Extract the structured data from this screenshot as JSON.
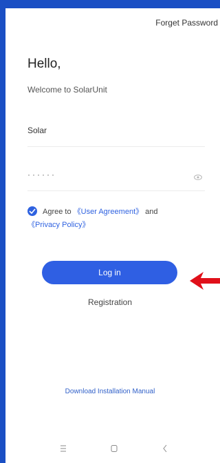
{
  "header": {
    "forget_password": "Forget Password"
  },
  "greeting": {
    "title": "Hello,",
    "subtitle": "Welcome to SolarUnit"
  },
  "form": {
    "username_value": "Solar",
    "password_mask": "······",
    "agree_prefix": "Agree to ",
    "user_agreement": "《User Agreement》",
    "and_text": " and",
    "privacy_policy": "《Privacy Policy》",
    "agree_checked": true
  },
  "actions": {
    "login_label": "Log in",
    "registration_label": "Registration",
    "download_manual": "Download Installation Manual"
  },
  "icons": {
    "password_toggle": "eye-icon",
    "checkbox": "check-icon",
    "nav_menu": "menu-icon",
    "nav_home": "square-home-icon",
    "nav_back": "chevron-left-icon",
    "annotation": "red-arrow-icon"
  },
  "colors": {
    "accent": "#2f5fe3",
    "frame": "#1a4fc4",
    "annotation": "#e0101a"
  }
}
